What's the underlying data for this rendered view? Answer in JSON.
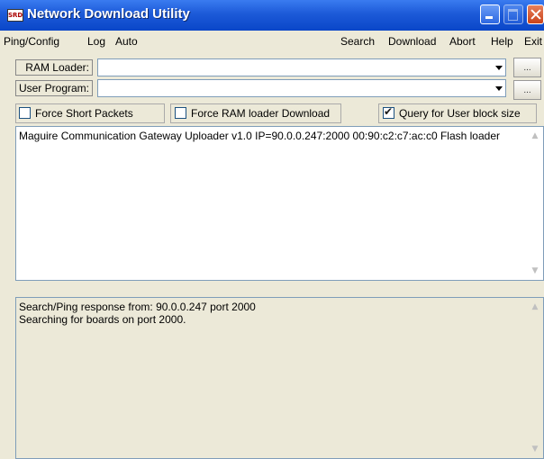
{
  "window": {
    "title": "Network Download Utility",
    "icon_text": "SRD",
    "titlebar_color": "#0a46c8"
  },
  "menu": {
    "left": [
      "Ping/Config",
      "Log",
      "Auto"
    ],
    "right": [
      "Search",
      "Download",
      "Abort",
      "Help",
      "Exit"
    ]
  },
  "ram_loader": {
    "label": "RAM Loader:",
    "value": "",
    "browse": "..."
  },
  "user_program": {
    "label": "User Program:",
    "value": "",
    "browse": "..."
  },
  "options": {
    "force_short_packets": {
      "label": "Force Short Packets",
      "checked": false
    },
    "force_ram_loader": {
      "label": "Force RAM loader Download",
      "checked": false
    },
    "query_user_block": {
      "label": "Query for User block size",
      "checked": true
    }
  },
  "device_list": [
    "Maguire Communication Gateway Uploader v1.0   IP=90.0.0.247:2000  00:90:c2:c7:ac:c0 Flash loader"
  ],
  "log_lines": [
    "Search/Ping response from: 90.0.0.247 port 2000",
    "Searching for boards on port 2000."
  ]
}
